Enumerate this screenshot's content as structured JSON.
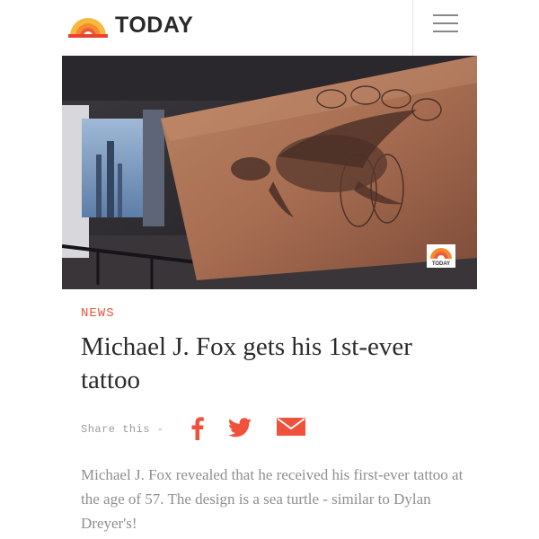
{
  "header": {
    "brand": "TODAY",
    "logo_icon": "today-rainbow-logo",
    "menu_icon": "hamburger-menu-icon"
  },
  "hero": {
    "watermark": "TODAY"
  },
  "article": {
    "category": "NEWS",
    "headline": "Michael J. Fox gets his 1st-ever tattoo",
    "share_label": "Share this -",
    "share_icons": [
      "facebook-icon",
      "twitter-icon",
      "email-icon"
    ],
    "summary": "Michael J. Fox revealed that he received his first-ever tattoo at the age of 57. The design is a sea turtle - similar to Dylan Dreyer's!"
  },
  "colors": {
    "accent": "#f0513b",
    "headline": "#2b2b2b",
    "body_text": "#8f8f8f"
  }
}
